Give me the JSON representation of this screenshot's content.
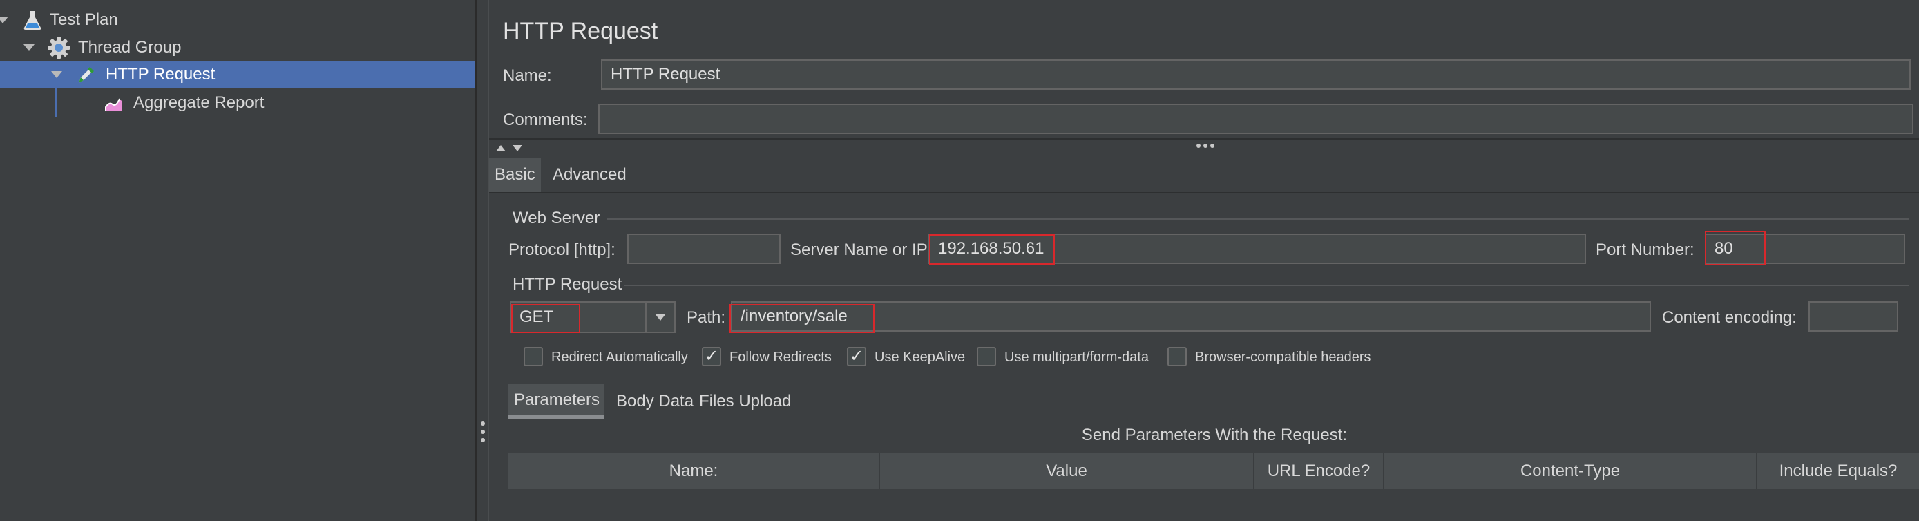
{
  "tree": {
    "items": [
      {
        "label": "Test Plan",
        "icon": "flask-icon"
      },
      {
        "label": "Thread Group",
        "icon": "gear-icon"
      },
      {
        "label": "HTTP Request",
        "icon": "pipette-icon"
      },
      {
        "label": "Aggregate Report",
        "icon": "chart-icon"
      }
    ]
  },
  "panel": {
    "title": "HTTP Request",
    "name_label": "Name:",
    "name_value": "HTTP Request",
    "comments_label": "Comments:",
    "comments_value": ""
  },
  "tabs": {
    "basic": "Basic",
    "advanced": "Advanced"
  },
  "web_server": {
    "section": "Web Server",
    "protocol_label": "Protocol [http]:",
    "protocol_value": "",
    "server_label": "Server Name or IP:",
    "server_value": "192.168.50.61",
    "port_label": "Port Number:",
    "port_value": "80"
  },
  "http_request": {
    "section": "HTTP Request",
    "method": "GET",
    "path_label": "Path:",
    "path_value": "/inventory/sale",
    "encoding_label": "Content encoding:",
    "encoding_value": ""
  },
  "options": [
    {
      "label": "Redirect Automatically",
      "checked": false
    },
    {
      "label": "Follow Redirects",
      "checked": true
    },
    {
      "label": "Use KeepAlive",
      "checked": true
    },
    {
      "label": "Use multipart/form-data",
      "checked": false
    },
    {
      "label": "Browser-compatible headers",
      "checked": false
    }
  ],
  "sub_tabs": {
    "parameters": "Parameters",
    "body_data": "Body Data",
    "files_upload": "Files Upload"
  },
  "parameters": {
    "caption": "Send Parameters With the Request:",
    "columns": [
      "Name:",
      "Value",
      "URL Encode?",
      "Content-Type",
      "Include Equals?"
    ]
  },
  "colors": {
    "background": "#3c3f41",
    "selection": "#4b6eaf",
    "highlight_box": "#d8282c"
  }
}
